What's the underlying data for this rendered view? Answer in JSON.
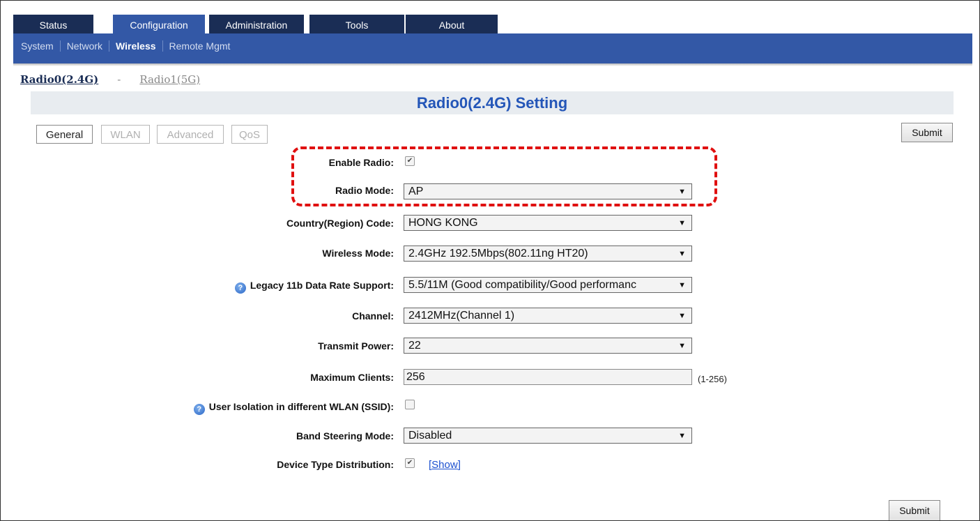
{
  "top_tabs": [
    "Status",
    "Configuration",
    "Administration",
    "Tools",
    "About"
  ],
  "sub_nav": [
    "System",
    "Network",
    "Wireless",
    "Remote Mgmt"
  ],
  "radio_links": {
    "current": "Radio0(2.4G)",
    "separator": "-",
    "other": "Radio1(5G)"
  },
  "page_title": "Radio0(2.4G) Setting",
  "sub_tabs": [
    "General",
    "WLAN",
    "Advanced",
    "QoS"
  ],
  "submit_label": "Submit",
  "fields": {
    "enable_radio": {
      "label": "Enable Radio:",
      "checked": true
    },
    "radio_mode": {
      "label": "Radio Mode:",
      "value": "AP"
    },
    "country_code": {
      "label": "Country(Region) Code:",
      "value": "HONG KONG"
    },
    "wireless_mode": {
      "label": "Wireless Mode:",
      "value": "2.4GHz 192.5Mbps(802.11ng HT20)"
    },
    "legacy_rate": {
      "label": "Legacy 11b Data Rate Support:",
      "value": "5.5/11M (Good compatibility/Good performanc"
    },
    "channel": {
      "label": "Channel:",
      "value": "2412MHz(Channel 1)"
    },
    "transmit_power": {
      "label": "Transmit Power:",
      "value": "22"
    },
    "max_clients": {
      "label": "Maximum Clients:",
      "value": "256",
      "hint": "(1-256)"
    },
    "user_isolation": {
      "label": "User Isolation in different WLAN (SSID):",
      "checked": false
    },
    "band_steering": {
      "label": "Band Steering Mode:",
      "value": "Disabled"
    },
    "device_type": {
      "label": "Device Type Distribution:",
      "checked": true,
      "link": "[Show]"
    }
  },
  "icons": {
    "help": "?",
    "check": "✔",
    "dropdown": "▼"
  },
  "colors": {
    "nav_dark": "#1a2d55",
    "nav_blue": "#3358a6",
    "title_blue": "#2456b8",
    "highlight": "#e01010"
  }
}
